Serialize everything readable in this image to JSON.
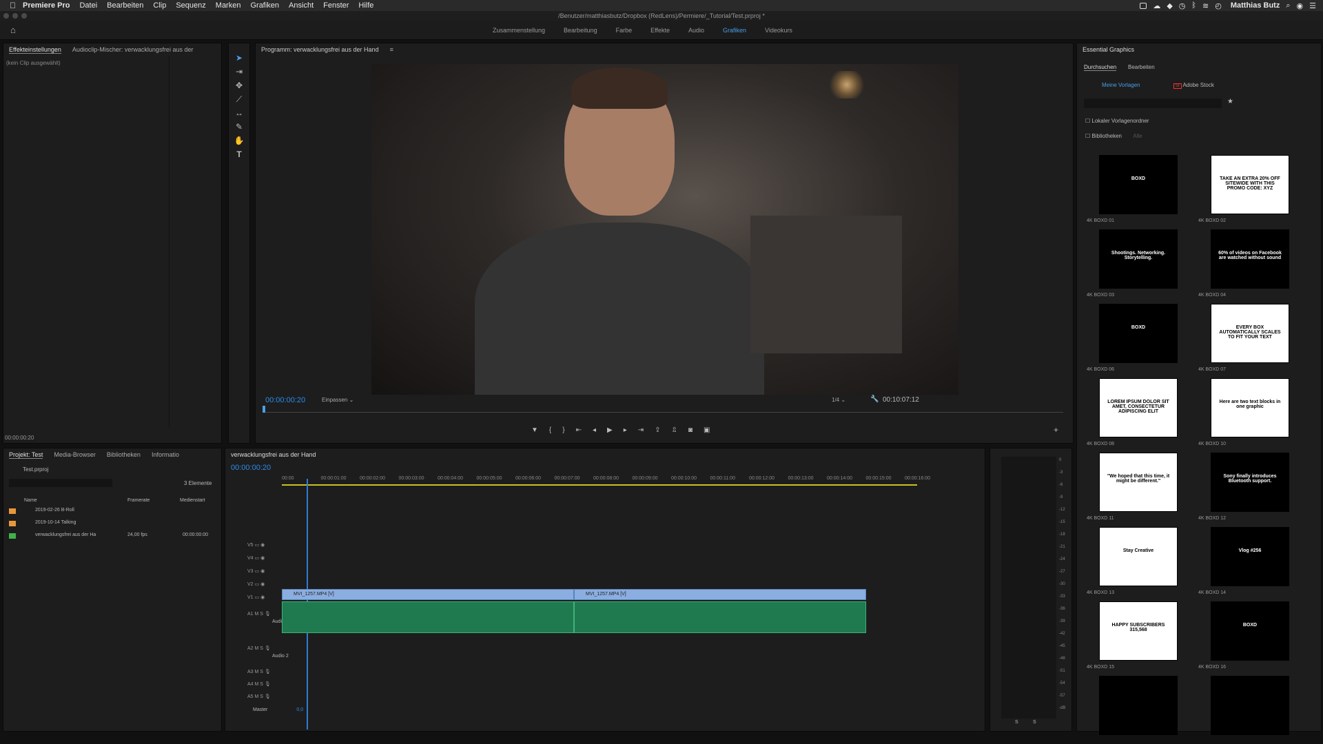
{
  "menubar": {
    "app_name": "Premiere Pro",
    "items": [
      "Datei",
      "Bearbeiten",
      "Clip",
      "Sequenz",
      "Marken",
      "Grafiken",
      "Ansicht",
      "Fenster",
      "Hilfe"
    ],
    "user": "Matthias Butz"
  },
  "title": "/Benutzer/matthiasbutz/Dropbox (RedLens)/Permiere/_Tutorial/Test.prproj *",
  "workspaces": [
    "Zusammenstellung",
    "Bearbeitung",
    "Farbe",
    "Effekte",
    "Audio",
    "Grafiken",
    "Videokurs"
  ],
  "active_workspace": "Grafiken",
  "effects_panel": {
    "tab1": "Effekteinstellungen",
    "tab2": "Audioclip-Mischer: verwacklungsfrei aus der",
    "no_clip": "(kein Clip ausgewählt)",
    "timecode": "00:00:00:20"
  },
  "program": {
    "title": "Programm: verwacklungsfrei aus der Hand",
    "timecode": "00:00:00:20",
    "fit": "Einpassen",
    "quality": "1/4",
    "duration": "00:10:07:12"
  },
  "project": {
    "tabs": [
      "Projekt: Test",
      "Media-Browser",
      "Bibliotheken",
      "Informatio"
    ],
    "file": "Test.prproj",
    "count": "3 Elemente",
    "columns": [
      "Name",
      "Framerate",
      "Medienstart"
    ],
    "rows": [
      {
        "name": "2019-02-26 B-Roll",
        "fps": "",
        "start": "",
        "color": "#e9973a"
      },
      {
        "name": "2019-10-14 Talking",
        "fps": "",
        "start": "",
        "color": "#e9973a"
      },
      {
        "name": "verwacklungsfrei aus der Ha",
        "fps": "24,00 fps",
        "start": "00:00:00:00",
        "color": "#3fb349"
      }
    ]
  },
  "timeline": {
    "tab": "verwacklungsfrei aus der Hand",
    "timecode": "00:00:00:20",
    "ruler": [
      "00:00",
      "00:00:01:00",
      "00:00:02:00",
      "00:00:03:00",
      "00:00:04:00",
      "00:00:05:00",
      "00:00:06:00",
      "00:00:07:00",
      "00:00:08:00",
      "00:00:09:00",
      "00:00:10:00",
      "00:00:11:00",
      "00:00:12:00",
      "00:00:13:00",
      "00:00:14:00",
      "00:00:15:00",
      "00:00:16:00"
    ],
    "video_tracks": [
      "V5",
      "V4",
      "V3",
      "V2",
      "V1"
    ],
    "audio_tracks": [
      "A1",
      "A2",
      "A3",
      "A4",
      "A5"
    ],
    "audio1_name": "Audio 1",
    "audio2_name": "Audio 2",
    "master": "Master",
    "master_value": "0,0",
    "clips": [
      "MVI_1257.MP4 [V]",
      "MVI_1257.MP4 [V]"
    ],
    "meter_scale": [
      "0",
      "-3",
      "-6",
      "-9",
      "-12",
      "-15",
      "-18",
      "-21",
      "-24",
      "-27",
      "-30",
      "-33",
      "-36",
      "-39",
      "-42",
      "-45",
      "-48",
      "-51",
      "-54",
      "-57",
      "-dB"
    ],
    "meter_bottom": [
      "S",
      "S"
    ]
  },
  "essential_graphics": {
    "title": "Essential Graphics",
    "tabs": [
      "Durchsuchen",
      "Bearbeiten"
    ],
    "sources": [
      "Meine Vorlagen",
      "Adobe Stock"
    ],
    "checkbox1": "Lokaler Vorlagenordner",
    "checkbox2": "Bibliotheken",
    "checkbox2_value": "Alle",
    "templates": [
      {
        "label": "4K BOXD 01",
        "text": "BOXD",
        "style": "dark"
      },
      {
        "label": "4K BOXD 02",
        "text": "TAKE AN EXTRA 20% OFF SITEWIDE WITH THIS PROMO CODE: XYZ",
        "style": "light"
      },
      {
        "label": "4K BOXD 03",
        "text": "Shootings. Networking. Storytelling.",
        "style": "dark"
      },
      {
        "label": "4K BOXD 04",
        "text": "60% of videos on Facebook are watched without sound",
        "style": "dark"
      },
      {
        "label": "4K BOXD 06",
        "text": "BOXD",
        "style": "dark"
      },
      {
        "label": "4K BOXD 07",
        "text": "EVERY BOX AUTOMATICALLY SCALES TO FIT YOUR TEXT",
        "style": "light"
      },
      {
        "label": "4K BOXD 08",
        "text": "LOREM IPSUM DOLOR SIT AMET, CONSECTETUR ADIPISCING ELIT",
        "style": "light"
      },
      {
        "label": "4K BOXD 10",
        "text": "Here are two text blocks in one graphic",
        "style": "light"
      },
      {
        "label": "4K BOXD 11",
        "text": "\"We hoped that this time, it might be different.\"",
        "style": "light"
      },
      {
        "label": "4K BOXD 12",
        "text": "Sony finally introduces Bluetooth support.",
        "style": "dark"
      },
      {
        "label": "4K BOXD 13",
        "text": "Stay Creative",
        "style": "light"
      },
      {
        "label": "4K BOXD 14",
        "text": "Vlog #256",
        "style": "dark"
      },
      {
        "label": "4K BOXD 15",
        "text": "HAPPY SUBSCRIBERS 315,568",
        "style": "light"
      },
      {
        "label": "4K BOXD 16",
        "text": "BOXD",
        "style": "dark"
      },
      {
        "label": "",
        "text": "",
        "style": "dark"
      },
      {
        "label": "",
        "text": "",
        "style": "dark"
      }
    ]
  }
}
